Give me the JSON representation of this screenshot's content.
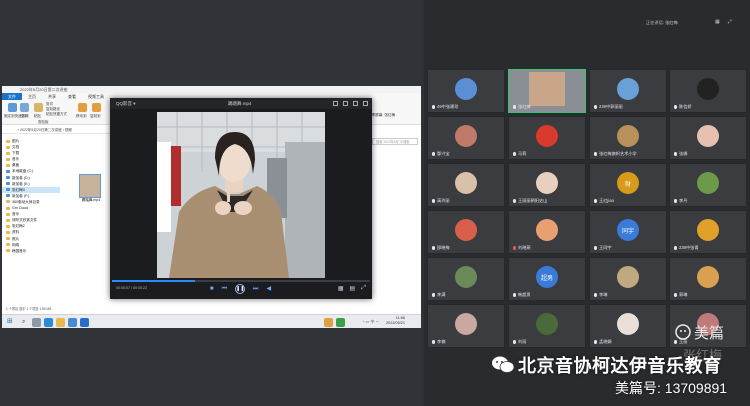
{
  "explorer": {
    "title": "2022年5月20日第二次讲座",
    "tabs": [
      "文件",
      "主页",
      "共享",
      "查看",
      "视频工具"
    ],
    "address": "› 2022年5月20日第二次讲座 › 视频",
    "ribbon_labels": [
      "固定到快速访问",
      "复制",
      "粘贴",
      "剪切",
      "复制路径",
      "粘贴快捷方式",
      "移动到",
      "复制到",
      "剪贴板"
    ],
    "nav_items": [
      "图片",
      "文档",
      "下载",
      "音乐",
      "桌面",
      "本地磁盘 (C:)",
      "新加卷 (D:)",
      "新加卷 (E:)",
      "张红梅3",
      "新加卷 (F:)",
      "360驱动大师目录",
      "Gm Cloud",
      "音乐",
      "倾听式欣赏文件",
      "张红梅2",
      "资料",
      "照片",
      "网络",
      "韩国音乐"
    ],
    "file_label": "踢踏舞.mp4",
    "status": "1 个项目   选中 1 个项目  1.85 MB",
    "second_window_title": "共享屏幕: 张红梅",
    "second_window_search": "搜索\"2022年5月\"中搜索"
  },
  "player": {
    "app_name": "QQ影音 ▾",
    "file_name": "踢踏舞.mp4",
    "time": "00:00:07 / 00:00:22",
    "progress": 0.32
  },
  "taskbar": {
    "time": "11:56",
    "date": "2022/05/21",
    "tray": "^ ▭ 中 ∽"
  },
  "meeting": {
    "speaker_prefix": "正在讲话:",
    "speaker_name": "张红梅",
    "participants": [
      {
        "name": "49中张建珍",
        "mic": "on",
        "avatar_color": "#5a8fd6"
      },
      {
        "name": "张红梅",
        "mic": "on",
        "avatar_color": "#c9a58a",
        "active": true
      },
      {
        "name": "239中郭丽丽",
        "mic": "on",
        "avatar_color": "#6aa0d8"
      },
      {
        "name": "陈信娇",
        "mic": "on",
        "avatar_color": "#222222"
      },
      {
        "name": "鄢兴宝",
        "mic": "on",
        "avatar_color": "#c07a6a"
      },
      {
        "name": "马莉",
        "mic": "on",
        "avatar_color": "#d83a2e"
      },
      {
        "name": "张红梅旗帜艺术小学",
        "mic": "on",
        "avatar_color": "#b8905a"
      },
      {
        "name": "张娜",
        "mic": "on",
        "avatar_color": "#e6c0b0"
      },
      {
        "name": "高玲丽",
        "mic": "on",
        "avatar_color": "#d9c0a8"
      },
      {
        "name": "王丽丽朝阳史山",
        "mic": "on",
        "avatar_color": "#e8d0c0"
      },
      {
        "name": "王红jiao",
        "mic": "on",
        "avatar_color": "#d89a1a",
        "avatar_text": "财"
      },
      {
        "name": "李丹",
        "mic": "on",
        "avatar_color": "#6a9a4a"
      },
      {
        "name": "邵晓梅",
        "mic": "on",
        "avatar_color": "#d8604a"
      },
      {
        "name": "刘晓燕",
        "mic": "off",
        "avatar_color": "#e8a070"
      },
      {
        "name": "王同宇",
        "mic": "on",
        "avatar_color": "#3a7ad8",
        "avatar_text": "同宇"
      },
      {
        "name": "239中张青",
        "mic": "on",
        "avatar_color": "#e0a02a"
      },
      {
        "name": "李满",
        "mic": "on",
        "avatar_color": "#6a8a5a"
      },
      {
        "name": "韩超男",
        "mic": "on",
        "avatar_color": "#3a7ad8",
        "avatar_text": "超男"
      },
      {
        "name": "李琳",
        "mic": "on",
        "avatar_color": "#c0a880"
      },
      {
        "name": "郭琳",
        "mic": "on",
        "avatar_color": "#d8a050"
      },
      {
        "name": "李楠",
        "mic": "on",
        "avatar_color": "#c8a8a0"
      },
      {
        "name": "刘丽",
        "mic": "on",
        "avatar_color": "#4a6a3a"
      },
      {
        "name": "孟晓娟",
        "mic": "on",
        "avatar_color": "#e8e0d8"
      },
      {
        "name": "王丽",
        "mic": "on",
        "avatar_color": "#c07a7a"
      }
    ]
  },
  "watermark": {
    "title": "北京音协柯达伊音乐教育",
    "number": "美篇号: 13709891",
    "meipian": "美篇",
    "corner_name": "张红梅"
  },
  "colors": {
    "active_border": "#37c46a",
    "player_accent": "#2b88ff",
    "file_tab": "#1a73c8"
  }
}
